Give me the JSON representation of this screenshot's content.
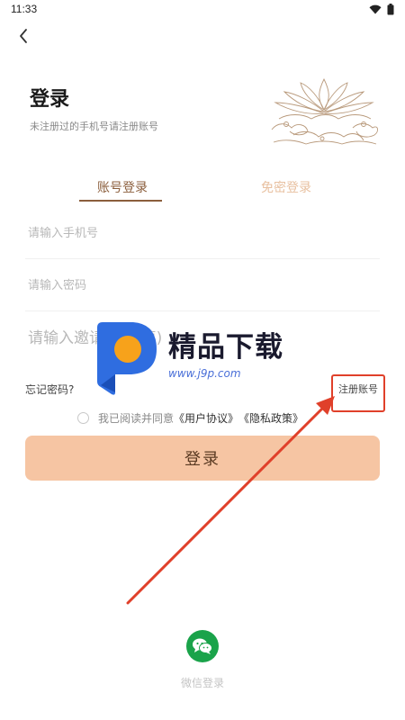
{
  "status_bar": {
    "time": "11:33"
  },
  "header": {
    "title": "登录",
    "subtitle": "未注册过的手机号请注册账号"
  },
  "tabs": [
    {
      "label": "账号登录",
      "active": true
    },
    {
      "label": "免密登录",
      "active": false
    }
  ],
  "form": {
    "phone_placeholder": "请输入手机号",
    "password_placeholder": "请输入密码",
    "invite_placeholder": "请输入邀请码(选填)"
  },
  "links": {
    "forgot_password": "忘记密码?",
    "register": "注册账号"
  },
  "agreement": {
    "prefix": "我已阅读并同意",
    "user_agreement": "《用户协议》",
    "privacy_policy": "《隐私政策》"
  },
  "login_button_label": "登录",
  "wechat": {
    "label": "微信登录"
  },
  "watermark": {
    "title": "精品下载",
    "url": "www.j9p.com"
  },
  "colors": {
    "accent": "#8b5e3c",
    "button": "#f6c5a3",
    "tab_inactive": "#e8c0a0",
    "wechat": "#1aa34a",
    "annotation": "#e0402a"
  },
  "icons": [
    "wifi-icon",
    "battery-icon",
    "back-arrow-icon",
    "lotus-illustration",
    "wechat-icon",
    "radio-icon"
  ]
}
